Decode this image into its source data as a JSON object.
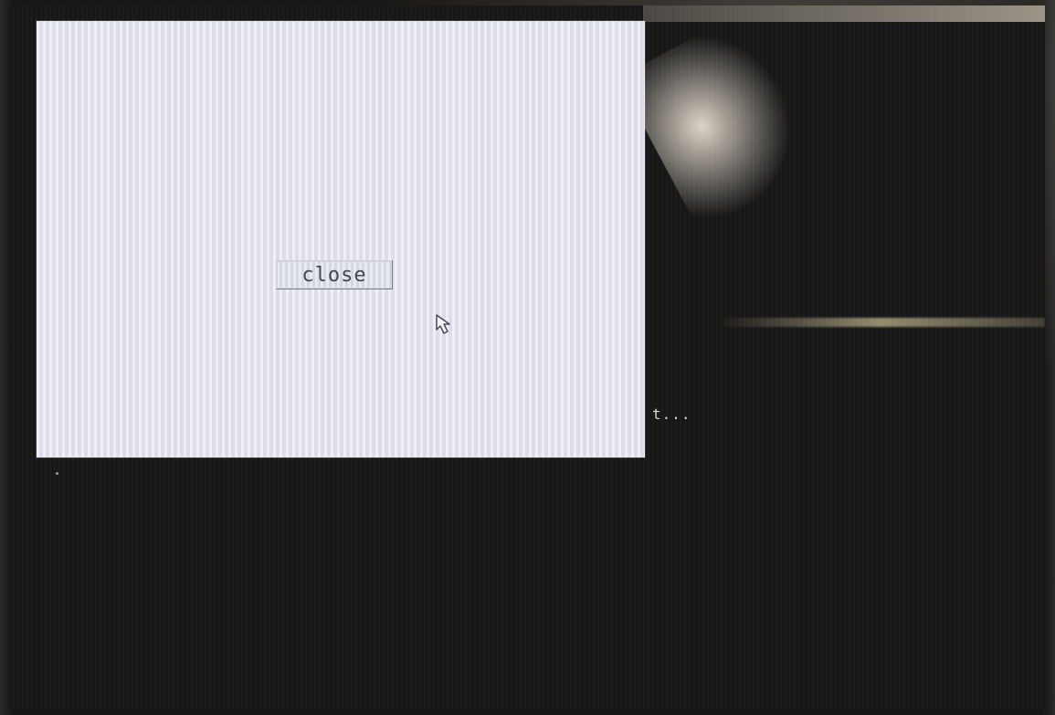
{
  "dialog": {
    "close_button_label": "close"
  },
  "terminal": {
    "text": "t..."
  },
  "icons": {
    "cursor": "mouse-pointer-icon"
  },
  "colors": {
    "dialog_background": "#e6e6ee",
    "screen_background": "#171717",
    "button_text": "#45474f"
  }
}
